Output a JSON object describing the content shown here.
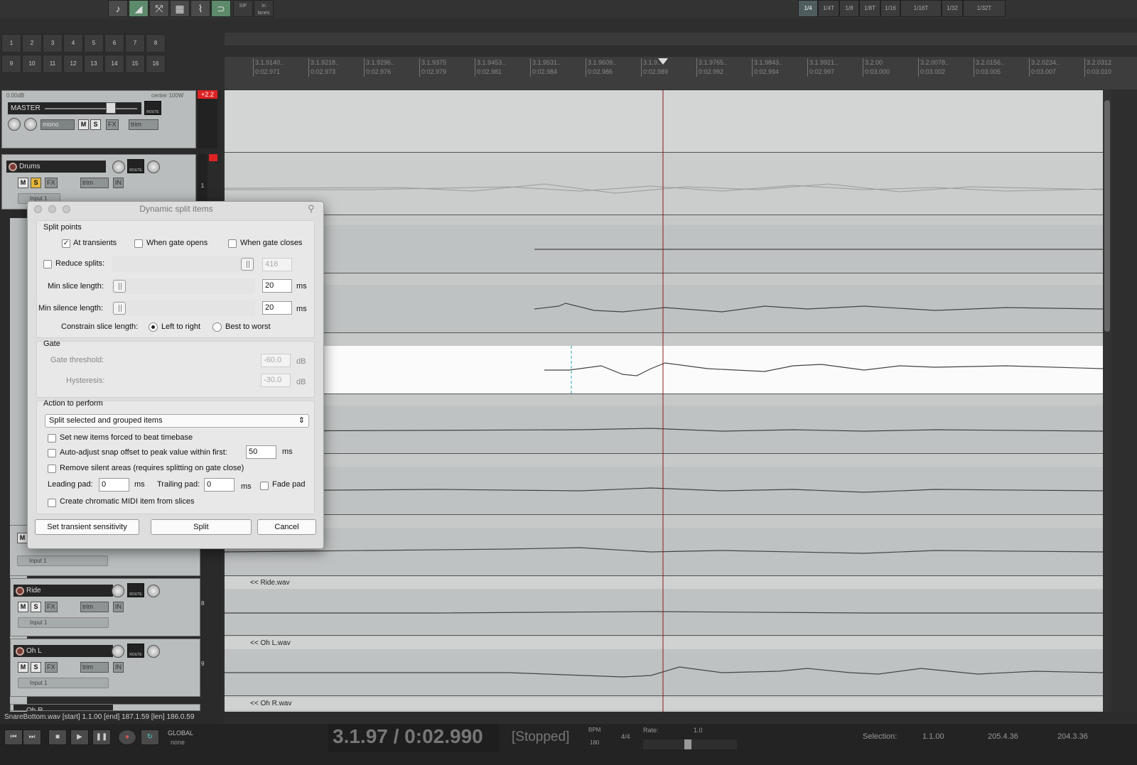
{
  "toolbar": {
    "metronome_icon": "metronome-icon",
    "sif": "SIF",
    "lanes": "In\nlanes"
  },
  "grid": [
    "1/4",
    "1/4T",
    "1/8",
    "1/8T",
    "1/16",
    "1/16T",
    "1/32",
    "1/32T"
  ],
  "track_numbers": [
    "1",
    "2",
    "3",
    "4",
    "5",
    "6",
    "7",
    "8",
    "9",
    "10",
    "11",
    "12",
    "13",
    "14",
    "15",
    "16"
  ],
  "ruler": [
    {
      "beat": "3.1.9140..",
      "time": "0:02.971"
    },
    {
      "beat": "3.1.9218..",
      "time": "0:02.973"
    },
    {
      "beat": "3.1.9296..",
      "time": "0:02.976"
    },
    {
      "beat": "3.1.9375",
      "time": "0:02.979"
    },
    {
      "beat": "3.1.9453..",
      "time": "0:02.981"
    },
    {
      "beat": "3.1.9531..",
      "time": "0:02.984"
    },
    {
      "beat": "3.1.9609..",
      "time": "0:02.986"
    },
    {
      "beat": "3.1.9..",
      "time": "0:02.989"
    },
    {
      "beat": "3.1.9765..",
      "time": "0:02.992"
    },
    {
      "beat": "3.1.9843..",
      "time": "0:02.994"
    },
    {
      "beat": "3.1.9921..",
      "time": "0:02.997"
    },
    {
      "beat": "3.2.00",
      "time": "0:03.000"
    },
    {
      "beat": "3.2.0078..",
      "time": "0:03.002"
    },
    {
      "beat": "3.2.0156..",
      "time": "0:03.005"
    },
    {
      "beat": "3.2.0234..",
      "time": "0:03.007"
    },
    {
      "beat": "3.2.0312",
      "time": "0:03.010"
    }
  ],
  "master": {
    "vol": "0.00dB",
    "pan": "center 100W",
    "name": "MASTER",
    "route": "ROUTE",
    "mono": "mono",
    "m": "M",
    "s": "S",
    "fx": "FX",
    "trim": "trim",
    "peak": "+2.2"
  },
  "tracks": {
    "drums": {
      "name": "Drums",
      "route": "ROUTE",
      "m": "M",
      "s": "S",
      "fx": "FX",
      "trim": "trim",
      "in": "IN",
      "input": "Input 1",
      "num": "1"
    },
    "t7": {
      "m": "M",
      "input": "Input 1"
    },
    "ride": {
      "name": "Ride",
      "route": "ROUTE",
      "m": "M",
      "s": "S",
      "fx": "FX",
      "trim": "trim",
      "in": "IN",
      "input": "Input 1",
      "num": "8"
    },
    "ohl": {
      "name": "Oh L",
      "route": "ROUTE",
      "m": "M",
      "s": "S",
      "fx": "FX",
      "trim": "trim",
      "in": "IN",
      "input": "Input 1",
      "num": "9"
    },
    "ohr": {
      "name": "Oh R"
    },
    "left_m": "M"
  },
  "items": {
    "ride": "<< Ride.wav",
    "ohl": "<< Oh L.wav",
    "ohr": "<< Oh R.wav"
  },
  "dialog": {
    "title": "Dynamic split items",
    "split_points": "Split points",
    "at_transients": "At transients",
    "gate_opens": "When gate opens",
    "gate_closes": "When gate closes",
    "reduce_splits": "Reduce splits:",
    "reduce_value": "416",
    "min_slice": "Min slice length:",
    "min_slice_value": "20",
    "min_silence": "Min silence length:",
    "min_silence_value": "20",
    "ms": "ms",
    "constrain": "Constrain slice length:",
    "left_to_right": "Left to right",
    "best_to_worst": "Best to worst",
    "gate": "Gate",
    "gate_threshold": "Gate threshold:",
    "gate_threshold_value": "-60.0",
    "hysteresis": "Hysteresis:",
    "hysteresis_value": "-30.0",
    "db": "dB",
    "action": "Action to perform",
    "action_select": "Split selected and grouped items",
    "beat_timebase": "Set new items forced to beat timebase",
    "auto_adjust": "Auto-adjust snap offset to peak value within first:",
    "auto_adjust_value": "50",
    "remove_silent": "Remove silent areas (requires splitting on gate close)",
    "leading_pad": "Leading pad:",
    "leading_value": "0",
    "trailing_pad": "Trailing pad:",
    "trailing_value": "0",
    "fade_pad": "Fade pad",
    "midi": "Create chromatic MIDI item from slices",
    "transient_btn": "Set transient sensitivity",
    "split_btn": "Split",
    "cancel_btn": "Cancel"
  },
  "status": "SnareBottom.wav [start] 1.1.00 [end] 187.1.59 [len] 186.0.59",
  "transport": {
    "position": "3.1.97 / 0:02.990",
    "state": "[Stopped]",
    "bpm_label": "BPM",
    "bpm": "180",
    "ts": "4/4",
    "rate_label": "Rate:",
    "rate": "1.0",
    "global": "GLOBAL",
    "none": "none",
    "selection_label": "Selection:",
    "sel_start": "1.1.00",
    "sel_end": "205.4.36",
    "sel_len": "204.3.36"
  }
}
